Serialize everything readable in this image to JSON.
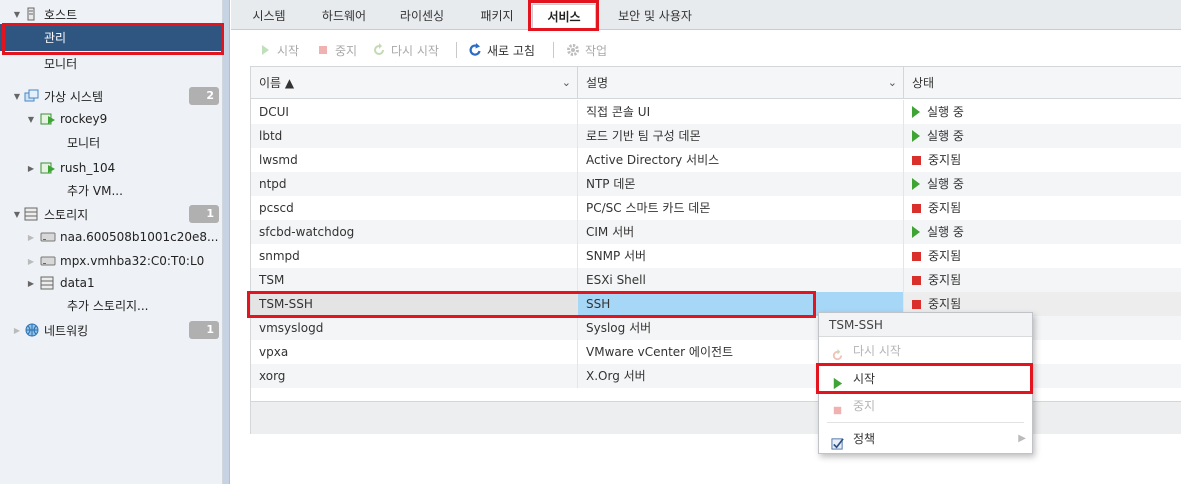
{
  "sidebar": {
    "host": {
      "label": "호스트"
    },
    "manage": {
      "label": "관리"
    },
    "monitor": {
      "label": "모니터"
    },
    "vms": {
      "label": "가상 시스템",
      "count": "2"
    },
    "vm1": {
      "label": "rockey9"
    },
    "vm1_monitor": {
      "label": "모니터"
    },
    "vm2": {
      "label": "rush_104"
    },
    "add_vm": {
      "label": "추가 VM..."
    },
    "storage": {
      "label": "스토리지",
      "count": "1"
    },
    "disk1": {
      "label": "naa.600508b1001c20e8..."
    },
    "disk2": {
      "label": "mpx.vmhba32:C0:T0:L0"
    },
    "datastore": {
      "label": "data1"
    },
    "add_storage": {
      "label": "추가 스토리지..."
    },
    "network": {
      "label": "네트워킹",
      "count": "1"
    }
  },
  "tabs": [
    "시스템",
    "하드웨어",
    "라이센싱",
    "패키지",
    "서비스",
    "보안 및 사용자"
  ],
  "toolbar": {
    "start": "시작",
    "stop": "중지",
    "restart": "다시 시작",
    "refresh": "새로 고침",
    "actions": "작업"
  },
  "grid": {
    "columns": {
      "name": "이름 ▲",
      "description": "설명",
      "status": "상태"
    },
    "rows": [
      {
        "name": "DCUI",
        "description": "직접 콘솔 UI",
        "status": "실행 중",
        "running": true
      },
      {
        "name": "lbtd",
        "description": "로드 기반 팀 구성 데몬",
        "status": "실행 중",
        "running": true
      },
      {
        "name": "lwsmd",
        "description": "Active Directory 서비스",
        "status": "중지됨",
        "running": false
      },
      {
        "name": "ntpd",
        "description": "NTP 데몬",
        "status": "실행 중",
        "running": true
      },
      {
        "name": "pcscd",
        "description": "PC/SC 스마트 카드 데몬",
        "status": "중지됨",
        "running": false
      },
      {
        "name": "sfcbd-watchdog",
        "description": "CIM 서버",
        "status": "실행 중",
        "running": true
      },
      {
        "name": "snmpd",
        "description": "SNMP 서버",
        "status": "중지됨",
        "running": false
      },
      {
        "name": "TSM",
        "description": "ESXi Shell",
        "status": "중지됨",
        "running": false
      },
      {
        "name": "TSM-SSH",
        "description": "SSH",
        "status": "중지됨",
        "running": false
      },
      {
        "name": "vmsyslogd",
        "description": "Syslog 서버",
        "status": "",
        "running": null
      },
      {
        "name": "vpxa",
        "description": "VMware vCenter 에이전트",
        "status": "",
        "running": null
      },
      {
        "name": "xorg",
        "description": "X.Org 서버",
        "status": "",
        "running": null
      }
    ]
  },
  "context_menu": {
    "title": "TSM-SSH",
    "restart": "다시 시작",
    "start": "시작",
    "stop": "중지",
    "policy": "정책"
  },
  "colors": {
    "selected_nav": "#2e5681",
    "highlight": "#e3141e",
    "running": "#3ea535",
    "stopped": "#d9302c",
    "selected_row": "#a7d7f7"
  }
}
